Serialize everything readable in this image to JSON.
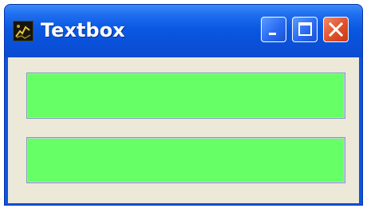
{
  "window": {
    "title": "Textbox"
  },
  "title_buttons": {
    "minimize_icon": "minimize-icon",
    "maximize_icon": "maximize-icon",
    "close_icon": "close-icon"
  },
  "textboxes": [
    {
      "value": ""
    },
    {
      "value": ""
    }
  ],
  "colors": {
    "titlebar": "#0a55e0",
    "client_background": "#ece9d8",
    "textbox_background": "#66ff66",
    "close_button": "#e0502a"
  }
}
